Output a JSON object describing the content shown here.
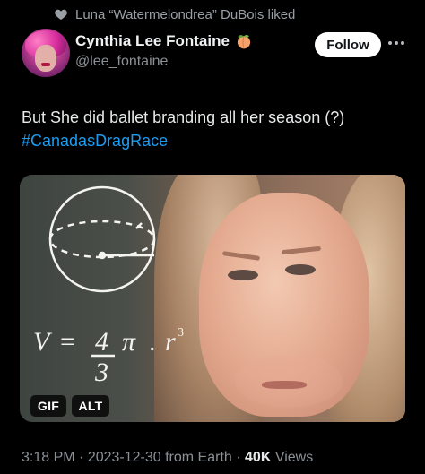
{
  "social_context": {
    "text": "Luna “Watermelondrea” DuBois liked",
    "icon": "heart-icon"
  },
  "author": {
    "display_name": "Cynthia Lee Fontaine",
    "name_emoji": "peach-icon",
    "handle": "@lee_fontaine",
    "avatar": "avatar-image"
  },
  "actions": {
    "follow_label": "Follow",
    "more_icon": "more-icon"
  },
  "tweet": {
    "text_line1": "But She did ballet branding all her season (?)",
    "hashtag": "#CanadasDragRace"
  },
  "media": {
    "description_icon": "math-lady-gif",
    "formula_v": "V",
    "formula_eq": "=",
    "formula_num": "4",
    "formula_den": "3",
    "formula_pi": "π",
    "formula_dot": ".",
    "formula_r": "r",
    "formula_exp": "3",
    "gif_badge": "GIF",
    "alt_badge": "ALT"
  },
  "meta": {
    "time": "3:18 PM",
    "separator1": " · ",
    "date": "2023-12-30",
    "source": " from Earth",
    "separator2": " · ",
    "views_count": "40K",
    "views_label": " Views"
  },
  "colors": {
    "link": "#1d9bf0",
    "background": "#000000",
    "muted": "#8b9095"
  }
}
